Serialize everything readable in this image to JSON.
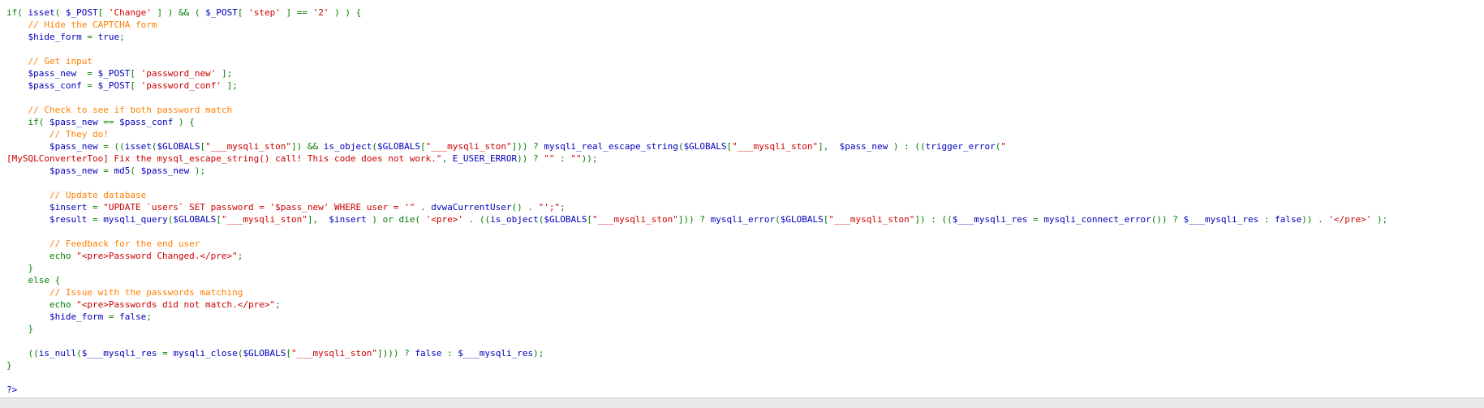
{
  "colors": {
    "keyword": "#007f00",
    "string": "#cc0000",
    "comment": "#ff7f00",
    "variable": "#0000bb",
    "function": "#0000bb",
    "background": "#ffffff",
    "statusbar": "#e9e9e9"
  },
  "code": {
    "lines": [
      [
        {
          "t": "kw",
          "v": "if( "
        },
        {
          "t": "fn",
          "v": "isset"
        },
        {
          "t": "kw",
          "v": "( "
        },
        {
          "t": "var",
          "v": "$_POST"
        },
        {
          "t": "kw",
          "v": "[ "
        },
        {
          "t": "str",
          "v": "'Change'"
        },
        {
          "t": "kw",
          "v": " ] ) && ( "
        },
        {
          "t": "var",
          "v": "$_POST"
        },
        {
          "t": "kw",
          "v": "[ "
        },
        {
          "t": "str",
          "v": "'step'"
        },
        {
          "t": "kw",
          "v": " ] == "
        },
        {
          "t": "str",
          "v": "'2'"
        },
        {
          "t": "kw",
          "v": " ) ) {"
        }
      ],
      [
        {
          "t": "kw",
          "v": "    "
        },
        {
          "t": "com",
          "v": "// Hide the CAPTCHA form"
        }
      ],
      [
        {
          "t": "kw",
          "v": "    "
        },
        {
          "t": "var",
          "v": "$hide_form"
        },
        {
          "t": "kw",
          "v": " = "
        },
        {
          "t": "fn",
          "v": "true"
        },
        {
          "t": "kw",
          "v": ";"
        }
      ],
      [],
      [
        {
          "t": "kw",
          "v": "    "
        },
        {
          "t": "com",
          "v": "// Get input"
        }
      ],
      [
        {
          "t": "kw",
          "v": "    "
        },
        {
          "t": "var",
          "v": "$pass_new"
        },
        {
          "t": "kw",
          "v": "  = "
        },
        {
          "t": "var",
          "v": "$_POST"
        },
        {
          "t": "kw",
          "v": "[ "
        },
        {
          "t": "str",
          "v": "'password_new'"
        },
        {
          "t": "kw",
          "v": " ];"
        }
      ],
      [
        {
          "t": "kw",
          "v": "    "
        },
        {
          "t": "var",
          "v": "$pass_conf"
        },
        {
          "t": "kw",
          "v": " = "
        },
        {
          "t": "var",
          "v": "$_POST"
        },
        {
          "t": "kw",
          "v": "[ "
        },
        {
          "t": "str",
          "v": "'password_conf'"
        },
        {
          "t": "kw",
          "v": " ];"
        }
      ],
      [],
      [
        {
          "t": "kw",
          "v": "    "
        },
        {
          "t": "com",
          "v": "// Check to see if both password match"
        }
      ],
      [
        {
          "t": "kw",
          "v": "    if( "
        },
        {
          "t": "var",
          "v": "$pass_new"
        },
        {
          "t": "kw",
          "v": " == "
        },
        {
          "t": "var",
          "v": "$pass_conf"
        },
        {
          "t": "kw",
          "v": " ) {"
        }
      ],
      [
        {
          "t": "kw",
          "v": "        "
        },
        {
          "t": "com",
          "v": "// They do!"
        }
      ],
      [
        {
          "t": "kw",
          "v": "        "
        },
        {
          "t": "var",
          "v": "$pass_new"
        },
        {
          "t": "kw",
          "v": " = (("
        },
        {
          "t": "fn",
          "v": "isset"
        },
        {
          "t": "kw",
          "v": "("
        },
        {
          "t": "var",
          "v": "$GLOBALS"
        },
        {
          "t": "kw",
          "v": "["
        },
        {
          "t": "str",
          "v": "\"___mysqli_ston\""
        },
        {
          "t": "kw",
          "v": "]) && "
        },
        {
          "t": "fn",
          "v": "is_object"
        },
        {
          "t": "kw",
          "v": "("
        },
        {
          "t": "var",
          "v": "$GLOBALS"
        },
        {
          "t": "kw",
          "v": "["
        },
        {
          "t": "str",
          "v": "\"___mysqli_ston\""
        },
        {
          "t": "kw",
          "v": "])) ? "
        },
        {
          "t": "fn",
          "v": "mysqli_real_escape_string"
        },
        {
          "t": "kw",
          "v": "("
        },
        {
          "t": "var",
          "v": "$GLOBALS"
        },
        {
          "t": "kw",
          "v": "["
        },
        {
          "t": "str",
          "v": "\"___mysqli_ston\""
        },
        {
          "t": "kw",
          "v": "],  "
        },
        {
          "t": "var",
          "v": "$pass_new"
        },
        {
          "t": "kw",
          "v": " ) : (("
        },
        {
          "t": "fn",
          "v": "trigger_error"
        },
        {
          "t": "kw",
          "v": "("
        },
        {
          "t": "str",
          "v": "\""
        }
      ],
      [
        {
          "t": "str",
          "v": "[MySQLConverterToo] Fix the mysql_escape_string() call! This code does not work.\""
        },
        {
          "t": "kw",
          "v": ", "
        },
        {
          "t": "fn",
          "v": "E_USER_ERROR"
        },
        {
          "t": "kw",
          "v": ")) ? "
        },
        {
          "t": "str",
          "v": "\"\""
        },
        {
          "t": "kw",
          "v": " : "
        },
        {
          "t": "str",
          "v": "\"\""
        },
        {
          "t": "kw",
          "v": "));"
        }
      ],
      [
        {
          "t": "kw",
          "v": "        "
        },
        {
          "t": "var",
          "v": "$pass_new"
        },
        {
          "t": "kw",
          "v": " = "
        },
        {
          "t": "fn",
          "v": "md5"
        },
        {
          "t": "kw",
          "v": "( "
        },
        {
          "t": "var",
          "v": "$pass_new"
        },
        {
          "t": "kw",
          "v": " );"
        }
      ],
      [],
      [
        {
          "t": "kw",
          "v": "        "
        },
        {
          "t": "com",
          "v": "// Update database"
        }
      ],
      [
        {
          "t": "kw",
          "v": "        "
        },
        {
          "t": "var",
          "v": "$insert"
        },
        {
          "t": "kw",
          "v": " = "
        },
        {
          "t": "str",
          "v": "\"UPDATE `users` SET password = '$pass_new' WHERE user = '\""
        },
        {
          "t": "kw",
          "v": " . "
        },
        {
          "t": "fn",
          "v": "dvwaCurrentUser"
        },
        {
          "t": "kw",
          "v": "() . "
        },
        {
          "t": "str",
          "v": "\"';\""
        },
        {
          "t": "kw",
          "v": ";"
        }
      ],
      [
        {
          "t": "kw",
          "v": "        "
        },
        {
          "t": "var",
          "v": "$result"
        },
        {
          "t": "kw",
          "v": " = "
        },
        {
          "t": "fn",
          "v": "mysqli_query"
        },
        {
          "t": "kw",
          "v": "("
        },
        {
          "t": "var",
          "v": "$GLOBALS"
        },
        {
          "t": "kw",
          "v": "["
        },
        {
          "t": "str",
          "v": "\"___mysqli_ston\""
        },
        {
          "t": "kw",
          "v": "],  "
        },
        {
          "t": "var",
          "v": "$insert"
        },
        {
          "t": "kw",
          "v": " ) or die( "
        },
        {
          "t": "str",
          "v": "'<pre>'"
        },
        {
          "t": "kw",
          "v": " . (("
        },
        {
          "t": "fn",
          "v": "is_object"
        },
        {
          "t": "kw",
          "v": "("
        },
        {
          "t": "var",
          "v": "$GLOBALS"
        },
        {
          "t": "kw",
          "v": "["
        },
        {
          "t": "str",
          "v": "\"___mysqli_ston\""
        },
        {
          "t": "kw",
          "v": "])) ? "
        },
        {
          "t": "fn",
          "v": "mysqli_error"
        },
        {
          "t": "kw",
          "v": "("
        },
        {
          "t": "var",
          "v": "$GLOBALS"
        },
        {
          "t": "kw",
          "v": "["
        },
        {
          "t": "str",
          "v": "\"___mysqli_ston\""
        },
        {
          "t": "kw",
          "v": "]) : (("
        },
        {
          "t": "var",
          "v": "$___mysqli_res"
        },
        {
          "t": "kw",
          "v": " = "
        },
        {
          "t": "fn",
          "v": "mysqli_connect_error"
        },
        {
          "t": "kw",
          "v": "()) ? "
        },
        {
          "t": "var",
          "v": "$___mysqli_res"
        },
        {
          "t": "kw",
          "v": " : "
        },
        {
          "t": "fn",
          "v": "false"
        },
        {
          "t": "kw",
          "v": ")) . "
        },
        {
          "t": "str",
          "v": "'</pre>'"
        },
        {
          "t": "kw",
          "v": " );"
        }
      ],
      [],
      [
        {
          "t": "kw",
          "v": "        "
        },
        {
          "t": "com",
          "v": "// Feedback for the end user"
        }
      ],
      [
        {
          "t": "kw",
          "v": "        echo "
        },
        {
          "t": "str",
          "v": "\"<pre>Password Changed.</pre>\""
        },
        {
          "t": "kw",
          "v": ";"
        }
      ],
      [
        {
          "t": "kw",
          "v": "    }"
        }
      ],
      [
        {
          "t": "kw",
          "v": "    else {"
        }
      ],
      [
        {
          "t": "kw",
          "v": "        "
        },
        {
          "t": "com",
          "v": "// Issue with the passwords matching"
        }
      ],
      [
        {
          "t": "kw",
          "v": "        echo "
        },
        {
          "t": "str",
          "v": "\"<pre>Passwords did not match.</pre>\""
        },
        {
          "t": "kw",
          "v": ";"
        }
      ],
      [
        {
          "t": "kw",
          "v": "        "
        },
        {
          "t": "var",
          "v": "$hide_form"
        },
        {
          "t": "kw",
          "v": " = "
        },
        {
          "t": "fn",
          "v": "false"
        },
        {
          "t": "kw",
          "v": ";"
        }
      ],
      [
        {
          "t": "kw",
          "v": "    }"
        }
      ],
      [],
      [
        {
          "t": "kw",
          "v": "    (("
        },
        {
          "t": "fn",
          "v": "is_null"
        },
        {
          "t": "kw",
          "v": "("
        },
        {
          "t": "var",
          "v": "$___mysqli_res"
        },
        {
          "t": "kw",
          "v": " = "
        },
        {
          "t": "fn",
          "v": "mysqli_close"
        },
        {
          "t": "kw",
          "v": "("
        },
        {
          "t": "var",
          "v": "$GLOBALS"
        },
        {
          "t": "kw",
          "v": "["
        },
        {
          "t": "str",
          "v": "\"___mysqli_ston\""
        },
        {
          "t": "kw",
          "v": "]))) ? "
        },
        {
          "t": "fn",
          "v": "false"
        },
        {
          "t": "kw",
          "v": " : "
        },
        {
          "t": "var",
          "v": "$___mysqli_res"
        },
        {
          "t": "kw",
          "v": ");"
        }
      ],
      [
        {
          "t": "kw",
          "v": "}"
        }
      ],
      [],
      [
        {
          "t": "var",
          "v": "?>"
        }
      ]
    ]
  }
}
